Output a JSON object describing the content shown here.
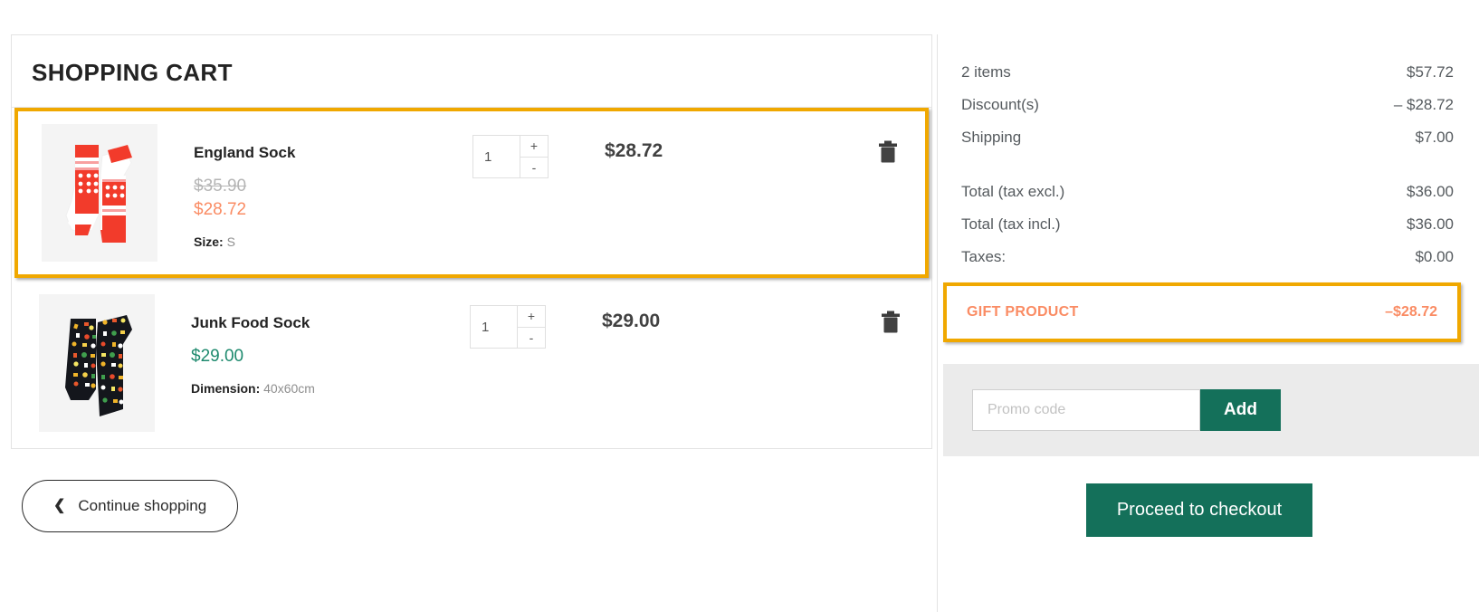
{
  "cart": {
    "title": "SHOPPING CART",
    "items": [
      {
        "name": "England Sock",
        "price_old": "$35.90",
        "price_new": "$28.72",
        "attr_label": "Size:",
        "attr_value": "S",
        "quantity": "1",
        "total": "$28.72",
        "plus_label": "+",
        "minus_label": "-",
        "thumb": "england-sock-thumbnail",
        "remove_icon": "trash-icon",
        "highlighted": true
      },
      {
        "name": "Junk Food Sock",
        "price_plain": "$29.00",
        "attr_label": "Dimension:",
        "attr_value": "40x60cm",
        "quantity": "1",
        "total": "$29.00",
        "plus_label": "+",
        "minus_label": "-",
        "thumb": "junk-food-sock-thumbnail",
        "remove_icon": "trash-icon",
        "highlighted": false
      }
    ]
  },
  "continue_shopping": {
    "label": "Continue shopping",
    "icon": "chevron-left-icon"
  },
  "summary": {
    "rows": [
      {
        "label": "2 items",
        "value": "$57.72"
      },
      {
        "label": "Discount(s)",
        "value": "– $28.72"
      },
      {
        "label": "Shipping",
        "value": "$7.00"
      }
    ],
    "totals": [
      {
        "label": "Total (tax excl.)",
        "value": "$36.00"
      },
      {
        "label": "Total (tax incl.)",
        "value": "$36.00"
      },
      {
        "label": "Taxes:",
        "value": "$0.00"
      }
    ],
    "gift": {
      "label": "GIFT PRODUCT",
      "value": "–$28.72"
    },
    "promo": {
      "placeholder": "Promo code",
      "add_label": "Add"
    },
    "checkout_label": "Proceed to checkout"
  },
  "colors": {
    "highlight_border": "#f0a800",
    "accent_orange": "#fa8c64",
    "green": "#14705a",
    "price_green": "#1e8a6e"
  }
}
